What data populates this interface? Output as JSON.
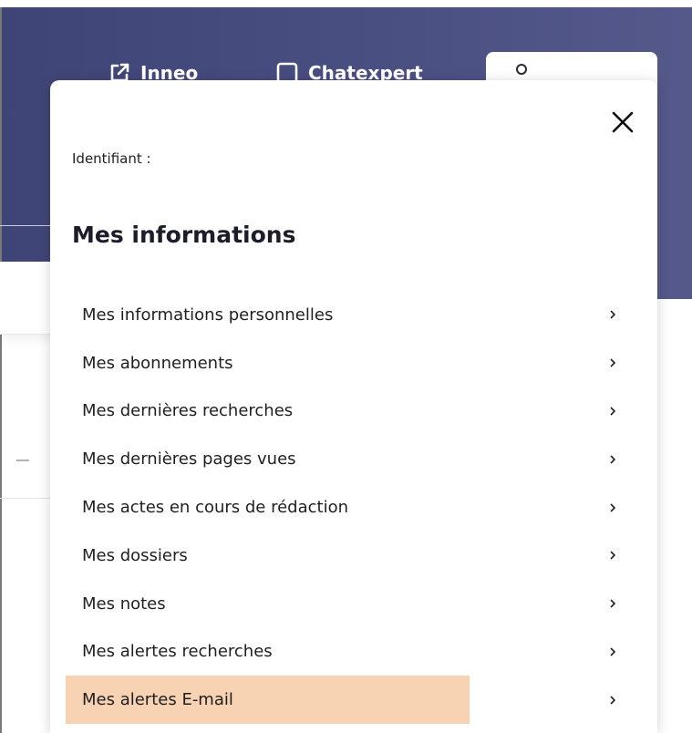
{
  "header": {
    "links": [
      {
        "label": "Inneo",
        "icon": "external-link-icon"
      },
      {
        "label": "Chatexpert",
        "icon": "square-icon"
      }
    ],
    "account_icon": "user-icon"
  },
  "panel": {
    "close_icon": "close-icon",
    "identifiant_label": "Identifiant :",
    "section_title": "Mes informations",
    "items": [
      {
        "label": "Mes informations personnelles"
      },
      {
        "label": "Mes abonnements"
      },
      {
        "label": "Mes dernières recherches"
      },
      {
        "label": "Mes dernières pages vues"
      },
      {
        "label": "Mes actes en cours de rédaction"
      },
      {
        "label": "Mes dossiers"
      },
      {
        "label": "Mes notes"
      },
      {
        "label": "Mes alertes recherches"
      },
      {
        "label": "Mes alertes E-mail",
        "active": true
      }
    ]
  },
  "colors": {
    "header_bg": "#454a7e",
    "highlight": "#f7d2b3",
    "text": "#1f1f1f"
  }
}
